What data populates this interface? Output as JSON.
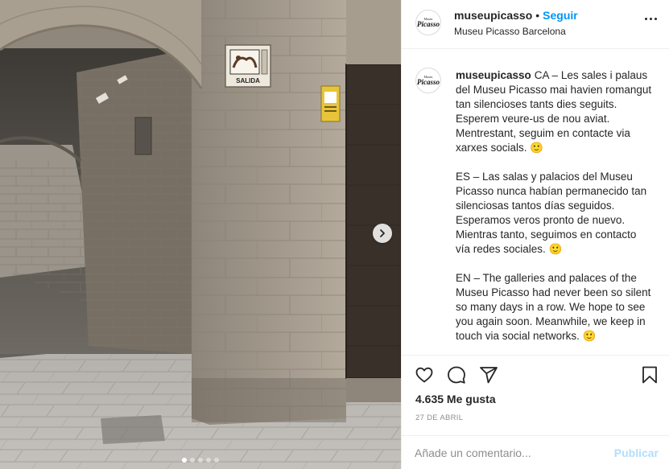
{
  "post": {
    "username": "museupicasso",
    "separator": "•",
    "follow_label": "Seguir",
    "location": "Museu Picasso Barcelona",
    "avatar_line1": "Museu",
    "avatar_line2": "Picasso",
    "photo_sign_text": "SALIDA",
    "caption_paragraphs": [
      "CA – Les sales i palaus del Museu Picasso mai havien romangut tan silencioses tants dies seguits. Esperem veure-us de nou aviat. Mentrestant, seguim en contacte via xarxes socials. 🙂",
      "ES – Las salas y palacios del Museu Picasso nunca habían permanecido tan silenciosas tantos días seguidos. Esperamos veros pronto de nuevo. Mientras tanto, seguimos en contacto vía redes sociales. 🙂",
      "EN – The galleries and palaces of the Museu Picasso had never been so silent so many days in a row. We hope to see you again soon. Meanwhile, we keep in touch via social networks. 🙂"
    ],
    "likes_text": "4.635 Me gusta",
    "date_text": "27 DE ABRIL",
    "carousel": {
      "slide_count": 5,
      "active_index": 0
    }
  },
  "comment": {
    "placeholder": "Añade un comentario...",
    "publish_label": "Publicar"
  },
  "icons": [
    "heart-icon",
    "comment-icon",
    "share-icon",
    "bookmark-icon",
    "more-options-icon",
    "chevron-right-icon"
  ],
  "colors": {
    "accent": "#0095f6",
    "publish_disabled": "#b2dffc",
    "text": "#262626",
    "muted": "#8e8e8e",
    "border": "#efefef"
  }
}
